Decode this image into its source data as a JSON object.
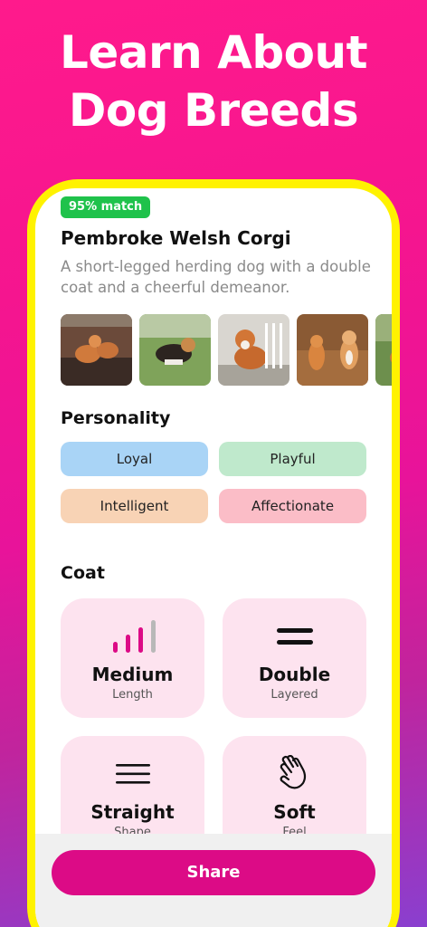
{
  "headline": {
    "line1": "Learn About",
    "line2": "Dog Breeds"
  },
  "breed": {
    "match_badge": "95% match",
    "name": "Pembroke Welsh Corgi",
    "description": "A short-legged herding dog with a double coat and a cheerful demeanor."
  },
  "personality": {
    "title": "Personality",
    "traits": [
      "Loyal",
      "Playful",
      "Intelligent",
      "Affectionate"
    ]
  },
  "coat": {
    "title": "Coat",
    "cards": [
      {
        "value": "Medium",
        "label": "Length",
        "icon": "signal-bars-icon"
      },
      {
        "value": "Double",
        "label": "Layered",
        "icon": "double-line-icon"
      },
      {
        "value": "Straight",
        "label": "Shape",
        "icon": "three-lines-icon"
      },
      {
        "value": "Soft",
        "label": "Feel",
        "icon": "hand-icon"
      }
    ]
  },
  "actions": {
    "share_label": "Share"
  },
  "colors": {
    "accent": "#dc0b86",
    "badge": "#1fc24b",
    "frame": "#fff200"
  }
}
